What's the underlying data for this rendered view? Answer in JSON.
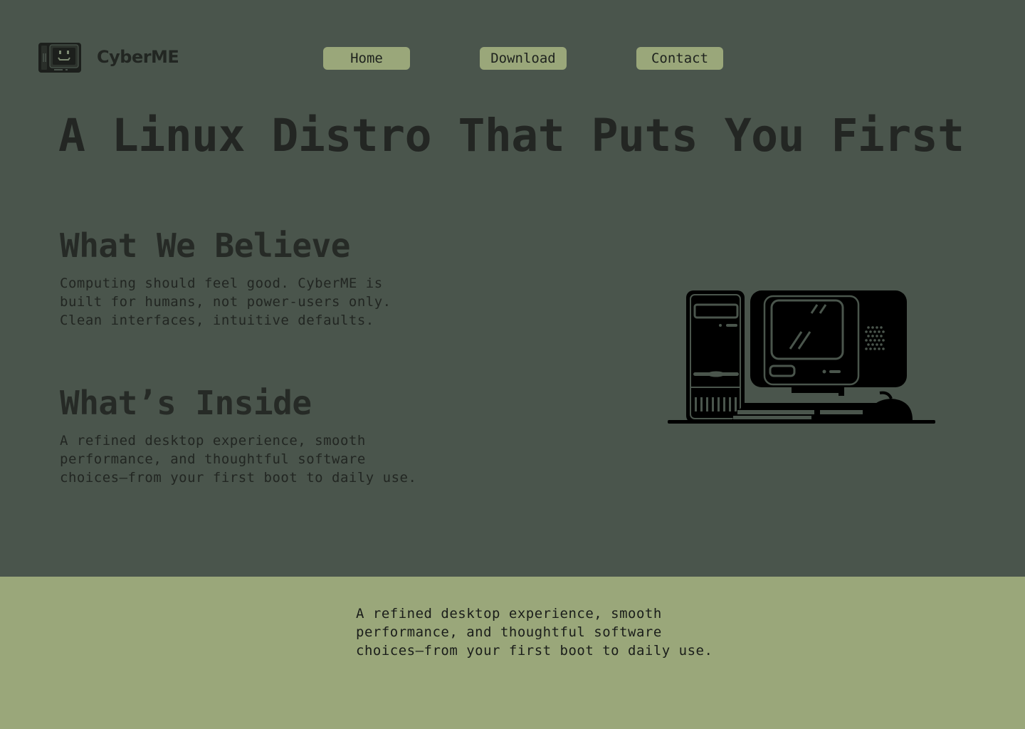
{
  "header": {
    "brand": "CyberME",
    "logo_icon": "retro-computer-face-icon"
  },
  "nav": {
    "home_label": "Home",
    "download_label": "Download",
    "contact_label": "Contact"
  },
  "hero": {
    "headline": "A Linux Distro That Puts You First"
  },
  "sections": {
    "believe": {
      "title": "What We Believe",
      "text": "Computing should feel good. CyberME is\nbuilt for humans, not power-users only.\nClean interfaces, intuitive defaults."
    },
    "inside": {
      "title": "What’s Inside",
      "text": "A refined desktop experience, smooth\nperformance, and thoughtful software\nchoices—from your first boot to daily use."
    }
  },
  "illustration": {
    "icon": "retro-computer-icon"
  },
  "footer": {
    "text": "A refined desktop experience, smooth\nperformance, and thoughtful software\nchoices—from your first boot to daily use."
  },
  "colors": {
    "background": "#4a554c",
    "accent": "#9aa77a",
    "text_dark": "#232623"
  }
}
